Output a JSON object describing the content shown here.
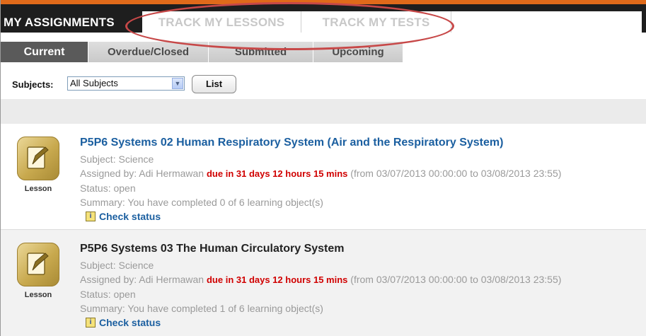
{
  "nav": {
    "assignments": "MY ASSIGNMENTS",
    "lessons": "TRACK MY LESSONS",
    "tests": "TRACK MY TESTS"
  },
  "subtabs": {
    "current": "Current",
    "overdue": "Overdue/Closed",
    "submitted": "Submitted",
    "upcoming": "Upcoming"
  },
  "filter": {
    "label": "Subjects:",
    "selected": "All Subjects",
    "button": "List"
  },
  "lessons": [
    {
      "icon_label": "Lesson",
      "title": "P5P6 Systems 02 Human Respiratory System (Air and the Respiratory System)",
      "subject": "Subject: Science",
      "assigned_prefix": "Assigned by: Adi Hermawan",
      "due": "due in 31 days 12 hours 15 mins",
      "range": "(from 03/07/2013 00:00:00 to 03/08/2013 23:55)",
      "status": "Status: open",
      "summary": "Summary: You have completed 0 of 6 learning object(s)",
      "check": "Check status"
    },
    {
      "icon_label": "Lesson",
      "title": "P5P6 Systems 03 The Human Circulatory System",
      "subject": "Subject: Science",
      "assigned_prefix": "Assigned by: Adi Hermawan",
      "due": "due in 31 days 12 hours 15 mins",
      "range": "(from 03/07/2013 00:00:00 to 03/08/2013 23:55)",
      "status": "Status: open",
      "summary": "Summary: You have completed 1 of 6 learning object(s)",
      "check": "Check status"
    }
  ],
  "colors": {
    "accent": "#e06a1a",
    "nav_bg": "#1e1e1e",
    "link": "#1b5fa0",
    "due": "#d00000",
    "annotation": "#c74848"
  }
}
